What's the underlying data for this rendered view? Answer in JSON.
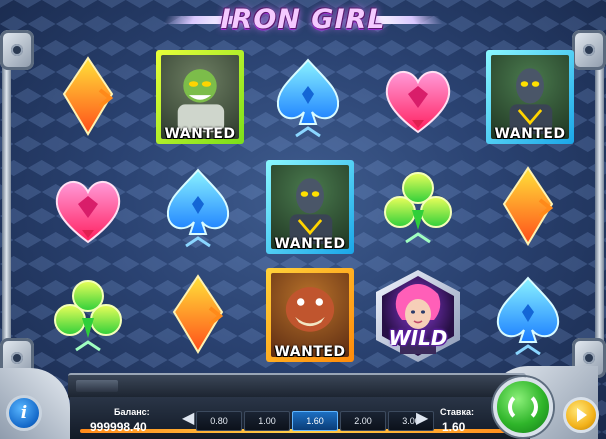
{
  "game": {
    "title": "IRON GIRL"
  },
  "reels": {
    "wanted_label": "WANTED",
    "wild_label": "WILD",
    "grid": [
      [
        "orange-diamond-symbol",
        "pink-heart-symbol",
        "green-club-symbol"
      ],
      [
        "wanted-alien-symbol",
        "blue-spade-symbol",
        "orange-diamond-symbol"
      ],
      [
        "blue-spade-symbol",
        "wanted-robot-symbol",
        "wanted-brute-symbol"
      ],
      [
        "pink-heart-symbol",
        "green-club-symbol",
        "wild-iron-girl-symbol"
      ],
      [
        "wanted-robot-symbol",
        "orange-diamond-symbol",
        "blue-spade-symbol"
      ]
    ]
  },
  "controls": {
    "balance_label": "Баланс:",
    "balance_value": "999998.40",
    "bet_label": "Ставка:",
    "bet_value": "1.60",
    "bet_options": [
      "0.80",
      "1.00",
      "1.60",
      "2.00",
      "3.00"
    ],
    "selected_bet": "1.60",
    "info_label": "i"
  },
  "colors": {
    "background": "#2a4271",
    "bet_selected": "#1c6fc2",
    "spin_button": "#2fb52a",
    "autoplay_button": "#f3b21a"
  }
}
